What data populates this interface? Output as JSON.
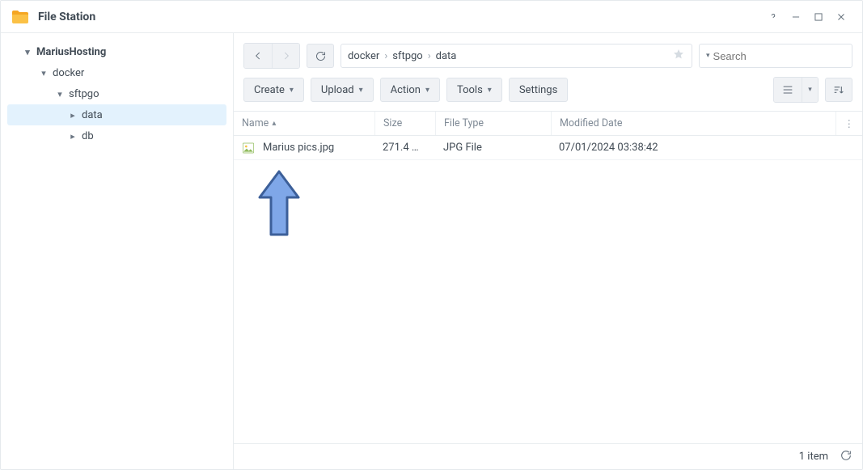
{
  "app": {
    "title": "File Station"
  },
  "window_controls": {
    "help_name": "help-icon",
    "minimize_name": "minimize-icon",
    "maximize_name": "maximize-icon",
    "close_name": "close-icon"
  },
  "sidebar": {
    "root": {
      "label": "MariusHosting"
    },
    "items": [
      {
        "label": "docker",
        "expanded": true,
        "children": [
          {
            "label": "sftpgo",
            "expanded": true,
            "children": [
              {
                "label": "data",
                "selected": true
              },
              {
                "label": "db"
              }
            ]
          }
        ]
      }
    ]
  },
  "toolbar": {
    "nav": {
      "back_name": "nav-back-icon",
      "forward_name": "nav-forward-icon"
    },
    "refresh_name": "refresh-icon",
    "breadcrumb": [
      "docker",
      "sftpgo",
      "data"
    ],
    "star_name": "favorite-star-icon",
    "search": {
      "placeholder": "Search",
      "icon_name": "search-icon"
    },
    "buttons": {
      "create": "Create",
      "upload": "Upload",
      "action": "Action",
      "tools": "Tools",
      "settings": "Settings"
    },
    "view": {
      "list_name": "list-view-icon",
      "list_caret_name": "view-split-caret",
      "sort_name": "sort-toggle-icon"
    }
  },
  "table": {
    "columns": {
      "name": "Name",
      "size": "Size",
      "type": "File Type",
      "date": "Modified Date"
    },
    "sort": {
      "column": "name",
      "dir": "asc"
    },
    "rows": [
      {
        "name": "Marius pics.jpg",
        "size": "271.4 …",
        "type": "JPG File",
        "date": "07/01/2024 03:38:42",
        "icon": "image-file-icon"
      }
    ],
    "more_name": "column-more-icon"
  },
  "status": {
    "count_label": "1 item",
    "refresh_name": "status-refresh-icon"
  },
  "overlay": {
    "arrow_name": "annotation-arrow-up"
  }
}
